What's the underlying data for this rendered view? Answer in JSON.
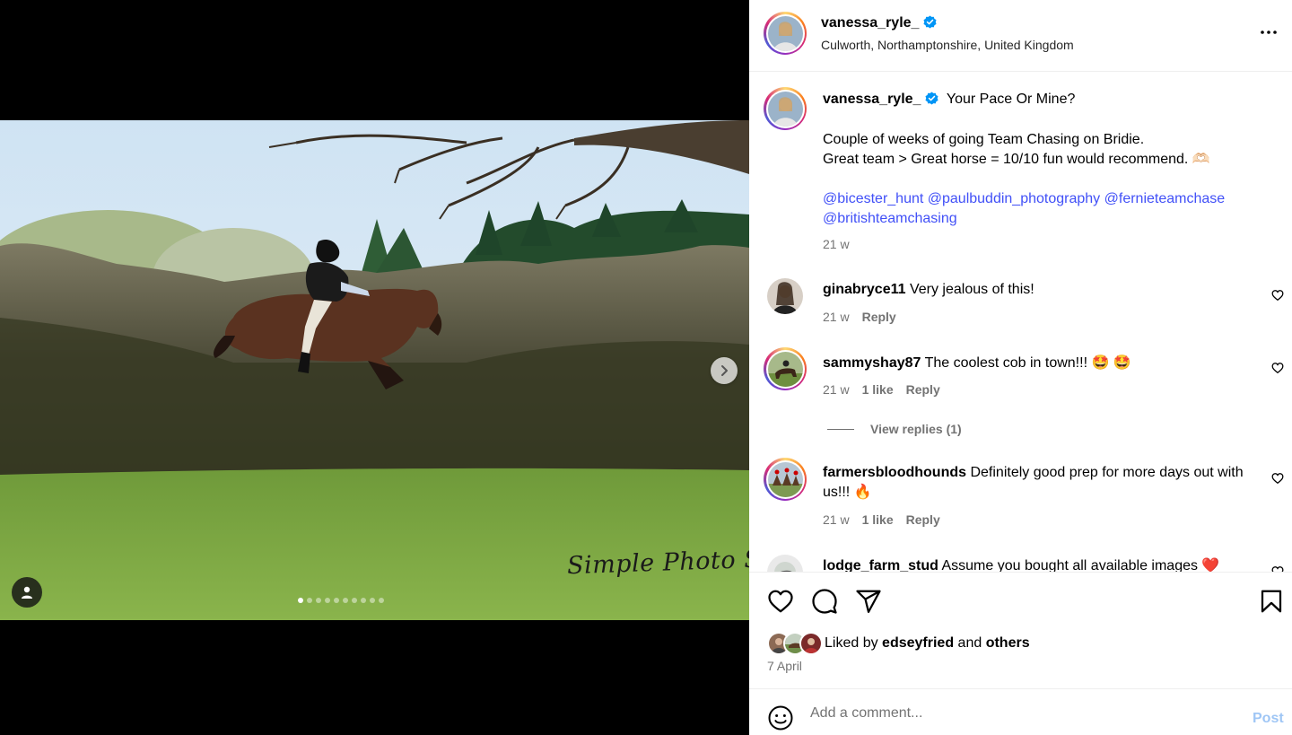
{
  "post": {
    "author": "vanessa_ryle_",
    "verified": true,
    "location": "Culworth, Northamptonshire, United Kingdom",
    "image_watermark": "Simple Photo Shots",
    "carousel": {
      "total": 10,
      "current": 1
    }
  },
  "caption": {
    "username": "vanessa_ryle_",
    "title": "Your Pace Or Mine?",
    "line1": "Couple of weeks of going Team Chasing on Bridie.",
    "line2": "Great team > Great horse = 10/10 fun would recommend. 🫶🏻",
    "mentions_line1": [
      "@bicester_hunt",
      "@paulbuddin_photography",
      "@fernieteamchase"
    ],
    "mentions_line2": [
      "@britishteamchasing"
    ],
    "time": "21 w"
  },
  "comments": [
    {
      "username": "ginabryce11",
      "text": "Very jealous of this!",
      "time": "21 w",
      "likes": "",
      "reply": "Reply"
    },
    {
      "username": "sammyshay87",
      "text": "The coolest cob in town!!! 🤩 🤩",
      "time": "21 w",
      "likes": "1 like",
      "reply": "Reply",
      "view_replies": "View replies (1)"
    },
    {
      "username": "farmersbloodhounds",
      "text": "Definitely good prep for more days out with us!!! 🔥",
      "time": "21 w",
      "likes": "1 like",
      "reply": "Reply"
    },
    {
      "username": "lodge_farm_stud",
      "text": "Assume you bought all available images ❤️"
    }
  ],
  "likes": {
    "prefix": "Liked by",
    "user": "edseyfried",
    "joiner": "and",
    "others": "others"
  },
  "date": "7 April",
  "composer": {
    "placeholder": "Add a comment...",
    "post_label": "Post"
  },
  "colors": {
    "mention": "#4150f7",
    "verified": "#0095f6",
    "post_disabled": "#9fc6f5",
    "secondary": "#737373"
  },
  "icons": [
    "more-icon",
    "heart-icon",
    "comment-icon",
    "share-icon",
    "bookmark-icon",
    "emoji-icon",
    "chevron-right-icon",
    "user-tag-icon",
    "verified-badge-icon"
  ]
}
